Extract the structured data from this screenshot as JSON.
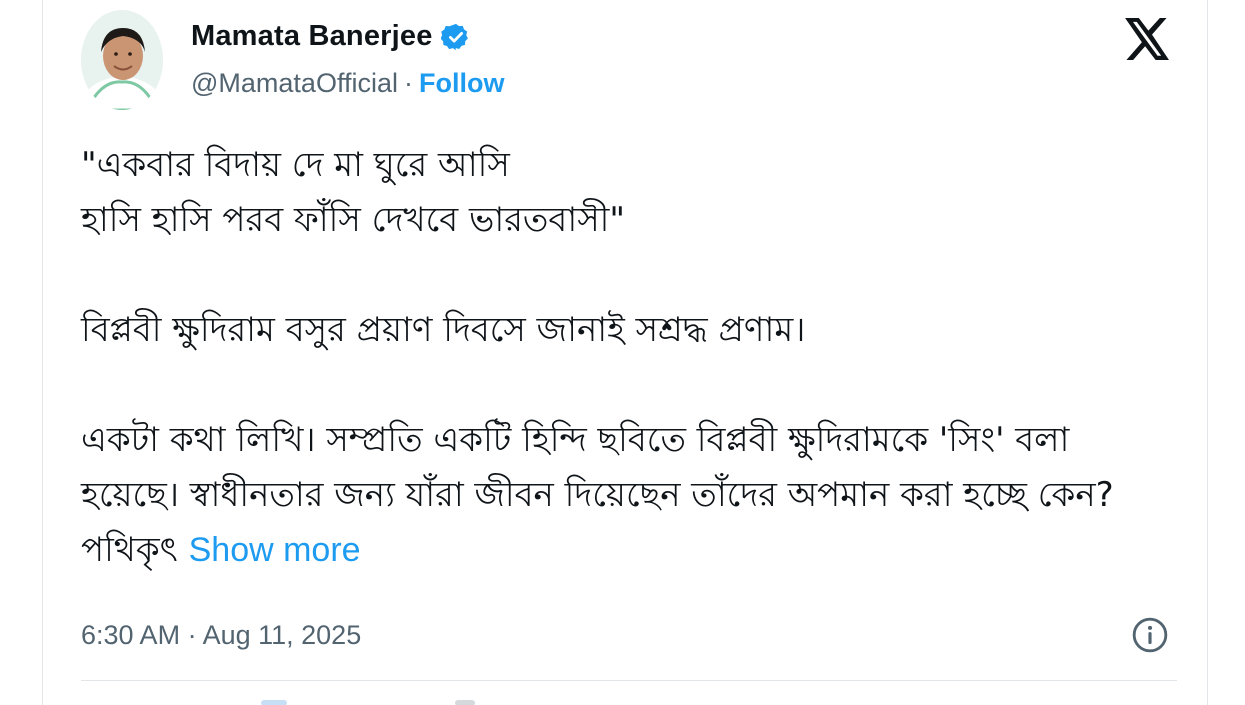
{
  "author": {
    "name": "Mamata Banerjee",
    "handle": "@MamataOfficial",
    "separator": "·",
    "follow_label": "Follow",
    "verified": true
  },
  "icons": {
    "verified": "verified-badge-icon",
    "logo": "x-logo-icon",
    "info": "info-icon"
  },
  "colors": {
    "link": "#1d9bf0",
    "text": "#0f1419",
    "muted": "#536471"
  },
  "tweet": {
    "line1": "\"একবার বিদায় দে মা ঘুরে আসি",
    "line2": "হাসি হাসি পরব ফাঁসি দেখবে ভারতবাসী\"",
    "line3": "বিপ্লবী ক্ষুদিরাম বসুর প্রয়াণ দিবসে জানাই সশ্রদ্ধ প্রণাম।",
    "line4": "একটা কথা লিখি। সম্প্রতি একটি হিন্দি ছবিতে বিপ্লবী ক্ষুদিরামকে 'সিং' বলা হয়েছে। স্বাধীনতার জন্য যাঁরা জীবন দিয়েছেন তাঁদের অপমান করা হচ্ছে কেন? পথিকৃৎ",
    "show_more": "Show more"
  },
  "timestamp": "6:30 AM · Aug 11, 2025"
}
